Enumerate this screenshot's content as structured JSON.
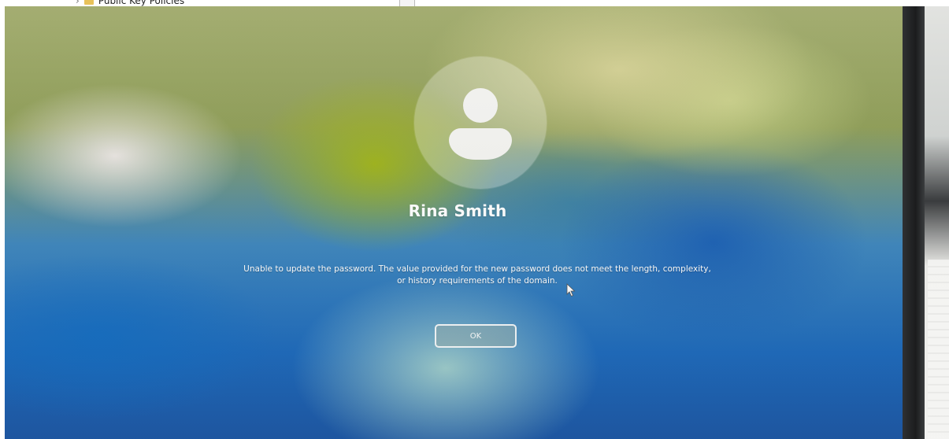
{
  "background_window": {
    "tree_item_label": "Public Key Policies",
    "icons": {
      "expand": "chevron-right-icon",
      "folder": "folder-icon"
    }
  },
  "lock_screen": {
    "avatar_icon": "user-avatar-icon",
    "user_name": "Rina Smith",
    "message": "Unable to update the password. The value provided for the new password does not meet the length, complexity, or history requirements of the domain.",
    "ok_label": "OK"
  },
  "colors": {
    "text": "#ffffff",
    "button_border": "#ffffff"
  }
}
